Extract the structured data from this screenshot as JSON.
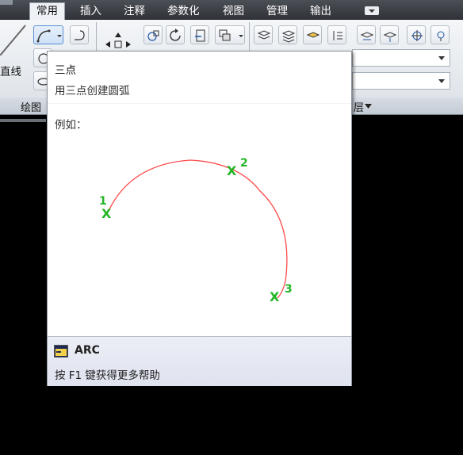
{
  "tabs": [
    {
      "label": "常用",
      "active": true
    },
    {
      "label": "插入"
    },
    {
      "label": "注释"
    },
    {
      "label": "参数化"
    },
    {
      "label": "视图"
    },
    {
      "label": "管理"
    },
    {
      "label": "输出"
    }
  ],
  "ribbon": {
    "line_label": "直线",
    "panels": {
      "draw": "绘图",
      "layers_tail": "层"
    }
  },
  "tooltip": {
    "title": "三点",
    "description": "用三点创建圆弧",
    "example_label": "例如：",
    "points": [
      "1",
      "2",
      "3"
    ],
    "point_marker": "X",
    "command": "ARC",
    "help": "按 F1 键获得更多帮助",
    "colors": {
      "arc": "#ff4a4a",
      "marker": "#22b525"
    }
  }
}
